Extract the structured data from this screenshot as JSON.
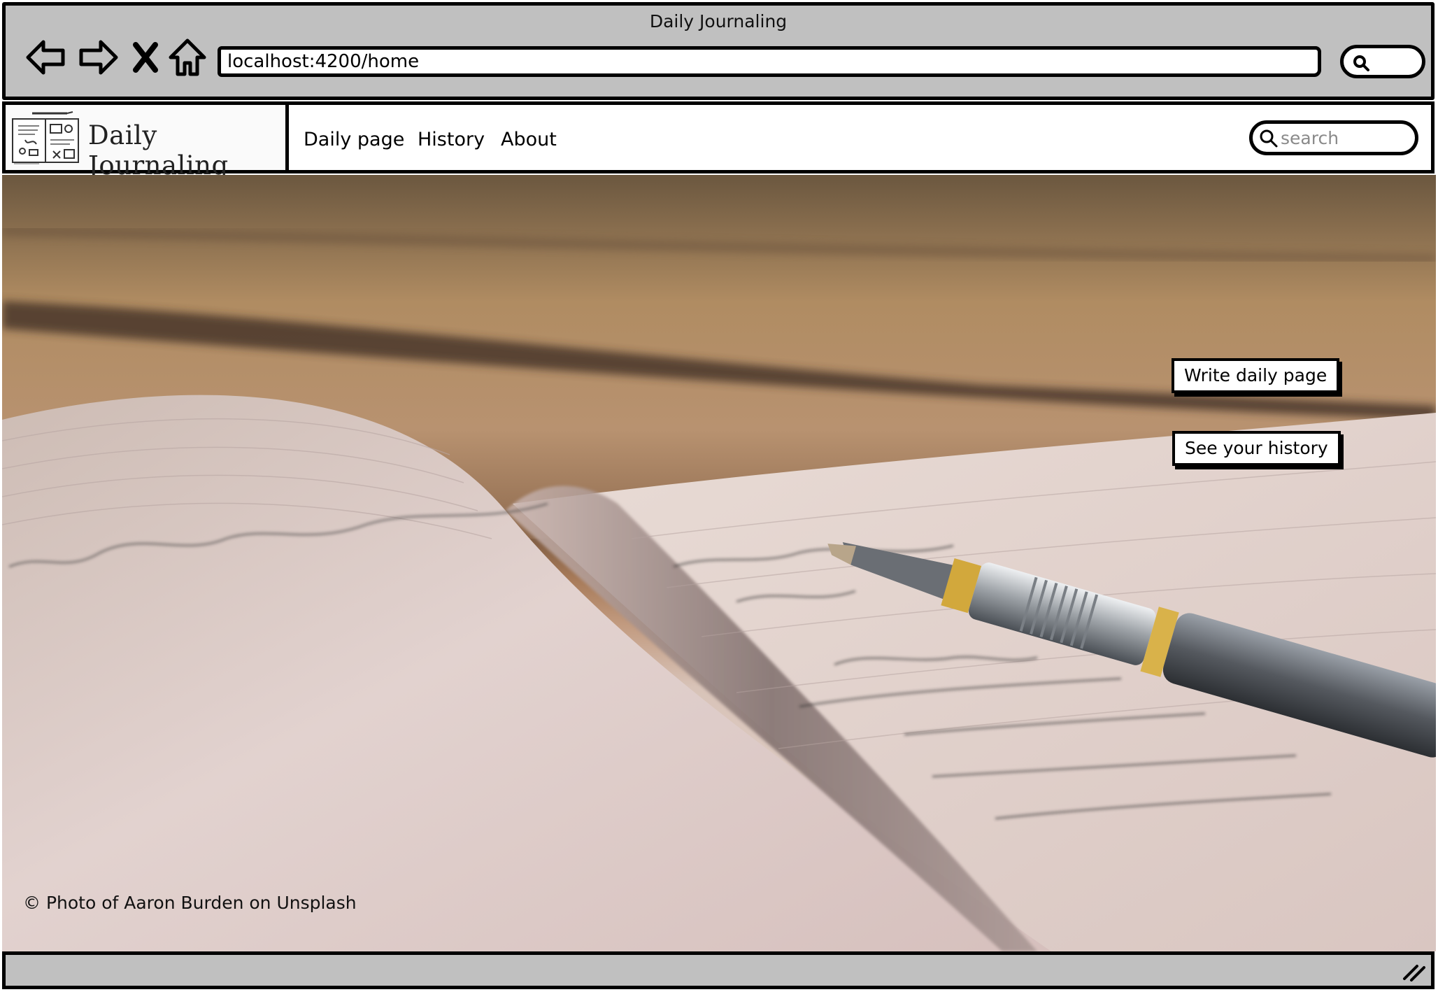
{
  "window": {
    "title": "Daily Journaling",
    "url": "localhost:4200/home",
    "nav_icons": [
      "back-arrow-icon",
      "forward-arrow-icon",
      "close-icon",
      "home-icon"
    ]
  },
  "header": {
    "logo_text": "Daily Journaling",
    "nav": [
      {
        "label": "Daily page"
      },
      {
        "label": "History"
      },
      {
        "label": "About"
      }
    ],
    "search_placeholder": "search"
  },
  "hero": {
    "primary_button": "Write daily page",
    "secondary_button": "See your history",
    "photo_credit": "© Photo of Aaron Burden on Unsplash"
  },
  "colors": {
    "chrome": "#c0c0c0",
    "border": "#000000",
    "wood": "#a88a62",
    "paper": "#e6d7d2"
  }
}
